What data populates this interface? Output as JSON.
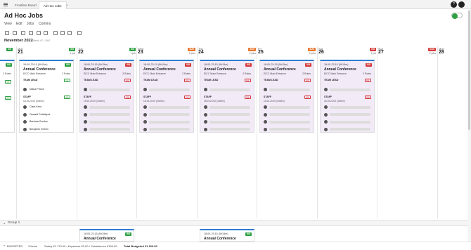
{
  "tabs": [
    {
      "label": "Frontline Board"
    },
    {
      "label": "Ad Hoc Jobs"
    },
    {
      "label": "+"
    }
  ],
  "user_initial": "?",
  "page_title": "Ad Hoc Jobs",
  "menu": [
    "View",
    "Edit",
    "Jobs",
    "Comms"
  ],
  "period": "November 2022",
  "week_label": "Week 47 • 2M7",
  "days": [
    {
      "name": "Mon",
      "num": "21",
      "badge": "5/5",
      "jobs": "1 job",
      "color": "#2ea043"
    },
    {
      "name": "Tue",
      "num": "22",
      "badge": "5/5",
      "jobs": "1 job",
      "color": "#2ea043"
    },
    {
      "name": "Wed",
      "num": "23",
      "badge": "3/20",
      "jobs": "2 jobs",
      "color": "#e8742a"
    },
    {
      "name": "Thu",
      "num": "24",
      "badge": "3/20",
      "jobs": "2 jobs",
      "color": "#e8742a"
    },
    {
      "name": "Fri",
      "num": "25",
      "badge": "3/20",
      "jobs": "2 jobs",
      "color": "#e8742a"
    },
    {
      "name": "Sat",
      "num": "26",
      "badge": "0/5",
      "jobs": "1 job",
      "color": "#d43a3a"
    },
    {
      "name": "Sun",
      "num": "27",
      "badge": "0/10",
      "jobs": "2 jobs",
      "color": "#d43a3a"
    },
    {
      "name": "Mon",
      "num": "28",
      "badge": "",
      "jobs": "",
      "color": ""
    }
  ],
  "left_badge": "0/5",
  "card_common": {
    "time": "18:00-23:15 (5h15m)",
    "name": "Annual Conference",
    "venue": "EICC Main Entrance",
    "roles": "2 Roles",
    "team_lead": "TEAM LEAD",
    "staff": "STAFF",
    "staff_time": "18:15-23:00 (4h45m)"
  },
  "cards": [
    {
      "badge": "5/5",
      "badge_color": "#2ea043",
      "lead_badge": "1/1",
      "staff_badge": "4/4",
      "lead_color": "#2ea043",
      "staff_color": "#2ea043",
      "lead_name": "Diana Prince",
      "staff_names": [
        "Clark Kent",
        "Oswald Cobblepot",
        "Barbara Gordon",
        "Benjamin Grimm"
      ]
    },
    {
      "badge": "0/5",
      "badge_color": "#d43a3a",
      "lead_badge": "0/1",
      "staff_badge": "0/4",
      "lead_color": "#d43a3a",
      "staff_color": "#d43a3a"
    },
    {
      "badge": "0/5",
      "badge_color": "#d43a3a",
      "lead_badge": "0/1",
      "staff_badge": "0/4",
      "lead_color": "#d43a3a",
      "staff_color": "#d43a3a"
    },
    {
      "badge": "0/5",
      "badge_color": "#d43a3a",
      "lead_badge": "0/1",
      "staff_badge": "0/4",
      "lead_color": "#d43a3a",
      "staff_color": "#d43a3a"
    },
    {
      "badge": "0/5",
      "badge_color": "#d43a3a",
      "lead_badge": "0/1",
      "staff_badge": "0/4",
      "lead_color": "#d43a3a",
      "staff_color": "#d43a3a"
    },
    {
      "badge": "0/5",
      "badge_color": "#d43a3a",
      "lead_badge": "0/1",
      "staff_badge": "0/4",
      "lead_color": "#d43a3a",
      "staff_color": "#d43a3a"
    }
  ],
  "left_roles": "2 Roles",
  "left_lead_badge": "1/1",
  "left_staff_badge": "4/4",
  "group_label": "Group 1",
  "group_cards": [
    {
      "time": "18:00-23:15 (5h15m)",
      "badge": "5/5",
      "name": "Annual Conference"
    },
    {
      "time": "18:00-23:15 (5h15m)",
      "badge": "5/5",
      "name": "Annual Conference"
    }
  ],
  "footer": {
    "status": "BUDGETED",
    "items": "3 Items",
    "salary": "Salary £1 170.00 • Expenses £0.00 • Subsistence £150.00",
    "total": "Total Budgeted £1 320.00"
  }
}
